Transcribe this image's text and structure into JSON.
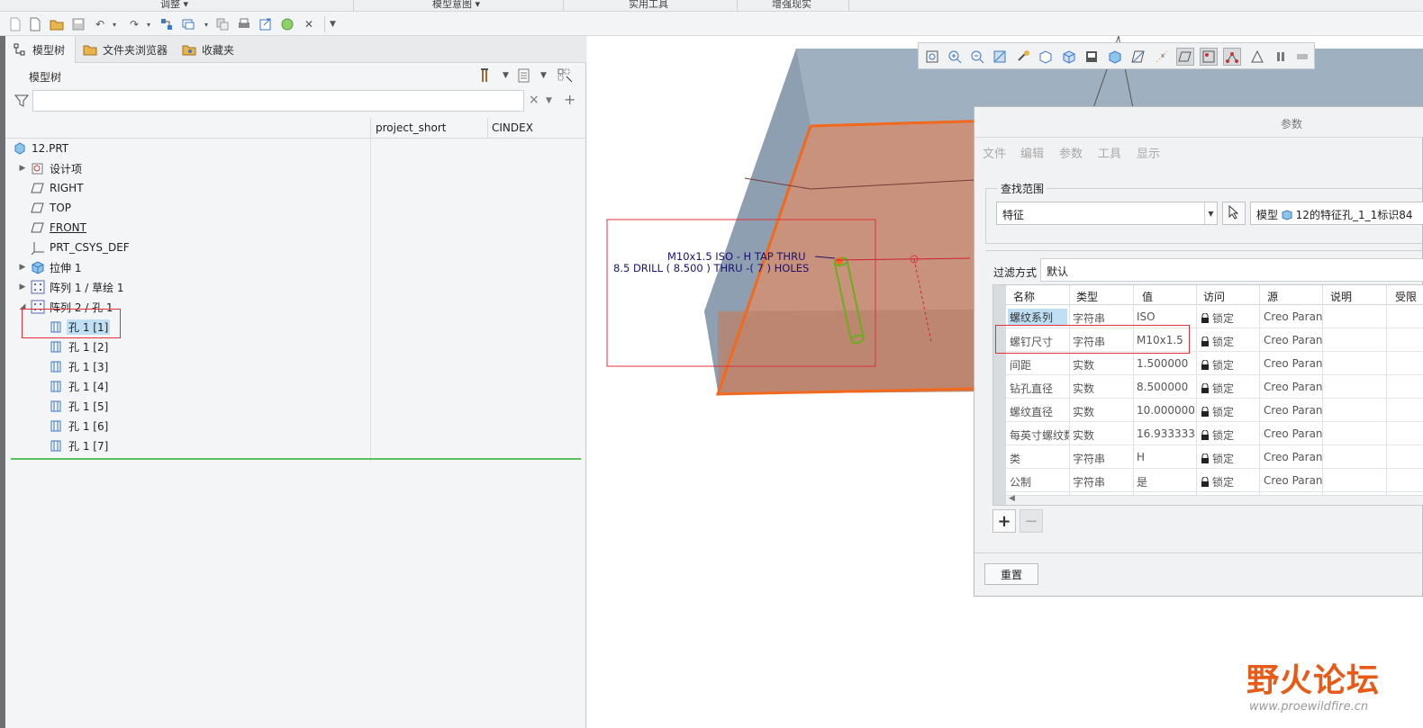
{
  "ribbon": {
    "groups": [
      "调整",
      "模型意图",
      "实用工具",
      "增强现实"
    ]
  },
  "tabs": [
    {
      "label": "模型树",
      "icon": "tree-icon"
    },
    {
      "label": "文件夹浏览器",
      "icon": "folder-browser-icon"
    },
    {
      "label": "收藏夹",
      "icon": "favorites-icon"
    }
  ],
  "model_tree": {
    "title": "模型树",
    "search_value": "",
    "columns": [
      "project_short",
      "CINDEX"
    ],
    "items": [
      {
        "label": "12.PRT",
        "icon": "part-icon"
      },
      {
        "label": "设计项",
        "icon": "design-items-icon"
      },
      {
        "label": "RIGHT",
        "icon": "datum-plane-icon"
      },
      {
        "label": "TOP",
        "icon": "datum-plane-icon"
      },
      {
        "label": "FRONT",
        "icon": "datum-plane-icon"
      },
      {
        "label": "PRT_CSYS_DEF",
        "icon": "csys-icon"
      },
      {
        "label": "拉伸 1",
        "icon": "extrude-icon"
      },
      {
        "label": "阵列 1 / 草绘 1",
        "icon": "pattern-icon"
      },
      {
        "label": "阵列 2 / 孔 1",
        "icon": "pattern-icon"
      },
      {
        "label": "孔 1 [1]",
        "icon": "hole-icon"
      },
      {
        "label": "孔 1 [2]",
        "icon": "hole-icon"
      },
      {
        "label": "孔 1 [3]",
        "icon": "hole-icon"
      },
      {
        "label": "孔 1 [4]",
        "icon": "hole-icon"
      },
      {
        "label": "孔 1 [5]",
        "icon": "hole-icon"
      },
      {
        "label": "孔 1 [6]",
        "icon": "hole-icon"
      },
      {
        "label": "孔 1 [7]",
        "icon": "hole-icon"
      }
    ]
  },
  "annotation": {
    "line1": "M10x1.5 ISO - H TAP  THRU",
    "line2": "8.5 DRILL ( 8.500 )  THRU  -( 7 ) HOLES"
  },
  "dialog": {
    "title": "参数",
    "menu": [
      "文件",
      "编辑",
      "参数",
      "工具",
      "显示"
    ],
    "scope_label": "查找范围",
    "scope_value": "特征",
    "model_label": "模型",
    "model_value": "12的特征孔_1_1标识84",
    "filter_label": "过滤方式",
    "filter_value": "默认",
    "columns": [
      "名称",
      "类型",
      "值",
      "访问",
      "源",
      "说明",
      "受限"
    ],
    "rows": [
      {
        "name": "螺纹系列",
        "type": "字符串",
        "value": "ISO",
        "access": "锁定",
        "source": "Creo Paran"
      },
      {
        "name": "螺钉尺寸",
        "type": "字符串",
        "value": "M10x1.5",
        "access": "锁定",
        "source": "Creo Paran"
      },
      {
        "name": "间距",
        "type": "实数",
        "value": "1.500000",
        "access": "锁定",
        "source": "Creo Paran"
      },
      {
        "name": "钻孔直径",
        "type": "实数",
        "value": "8.500000",
        "access": "锁定",
        "source": "Creo Paran"
      },
      {
        "name": "螺纹直径",
        "type": "实数",
        "value": "10.000000",
        "access": "锁定",
        "source": "Creo Paran"
      },
      {
        "name": "每英寸螺纹数",
        "type": "实数",
        "value": "16.933333",
        "access": "锁定",
        "source": "Creo Paran"
      },
      {
        "name": "类",
        "type": "字符串",
        "value": "H",
        "access": "锁定",
        "source": "Creo Paran"
      },
      {
        "name": "公制",
        "type": "字符串",
        "value": "是",
        "access": "锁定",
        "source": "Creo Paran"
      }
    ],
    "reset_label": "重置"
  },
  "watermark": {
    "logo": "野火论坛",
    "url": "www.proewildfire.cn"
  },
  "colors": {
    "accent_orange": "#f2691e",
    "selection_blue": "#bfe0f4",
    "highlight_red": "#e0313a",
    "hole_green": "#6aae1c"
  }
}
